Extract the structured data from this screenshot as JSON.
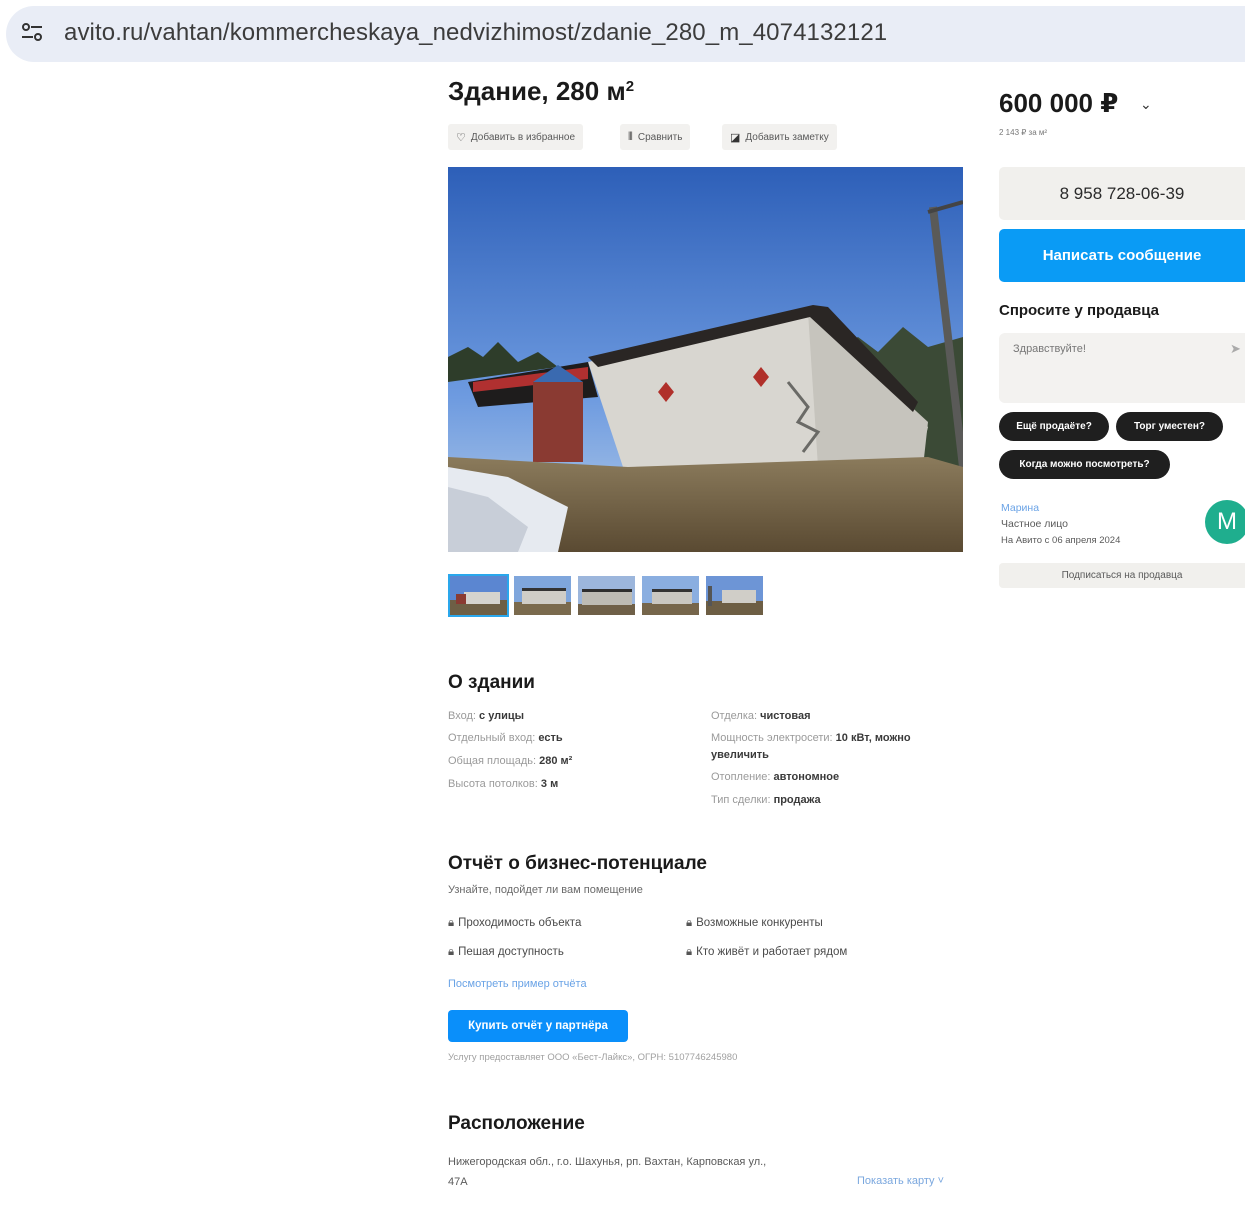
{
  "browser": {
    "url": "avito.ru/vahtan/kommercheskaya_nedvizhimost/zdanie_280_m_4074132121"
  },
  "listing": {
    "title_main": "Здание, 280 м",
    "title_sup": "2",
    "actions": {
      "favorite": "Добавить в избранное",
      "compare": "Сравнить",
      "note": "Добавить заметку"
    }
  },
  "gallery": {
    "thumbnail_count": 5,
    "active_index": 0
  },
  "about": {
    "heading": "О здании",
    "left": [
      {
        "label": "Вход:",
        "value": "с улицы"
      },
      {
        "label": "Отдельный вход:",
        "value": "есть"
      },
      {
        "label": "Общая площадь:",
        "value": "280 м²"
      },
      {
        "label": "Высота потолков:",
        "value": "3 м"
      }
    ],
    "right": [
      {
        "label": "Отделка:",
        "value": "чистовая"
      },
      {
        "label": "Мощность электросети:",
        "value": "10 кВт, можно",
        "value2": "увеличить"
      },
      {
        "label": "Отопление:",
        "value": "автономное"
      },
      {
        "label": "Тип сделки:",
        "value": "продажа"
      }
    ]
  },
  "report": {
    "heading": "Отчёт о бизнес-потенциале",
    "subtitle": "Узнайте, подойдет ли вам помещение",
    "items": [
      "Проходимость объекта",
      "Возможные конкуренты",
      "Пешая доступность",
      "Кто живёт и работает рядом"
    ],
    "example_link": "Посмотреть пример отчёта",
    "buy_button": "Купить отчёт у партнёра",
    "provider_note": "Услугу предоставляет ООО «Бест-Лайкс», ОГРН: 5107746245980"
  },
  "location": {
    "heading": "Расположение",
    "address_line1": "Нижегородская обл., г.о. Шахунья, рп. Вахтан, Карповская ул.,",
    "address_line2": "47А",
    "map_link": "Показать карту"
  },
  "sidebar": {
    "price": "600 000 ₽",
    "price_per_meter": "2 143 ₽ за м²",
    "phone": "8 958 728-06-39",
    "message_button": "Написать сообщение",
    "ask_heading": "Спросите у продавца",
    "ask_placeholder": "Здравствуйте!",
    "chips": [
      "Ещё продаёте?",
      "Торг уместен?",
      "Когда можно посмотреть?"
    ],
    "seller": {
      "name": "Марина",
      "type": "Частное лицо",
      "since": "На Авито с 06 апреля 2024",
      "avatar_letter": "M"
    },
    "subscribe_button": "Подписаться на продавца"
  },
  "colors": {
    "accent_blue": "#0a9bf5",
    "chip_dark": "#1f1f1f",
    "avatar_green": "#1fae8e"
  }
}
